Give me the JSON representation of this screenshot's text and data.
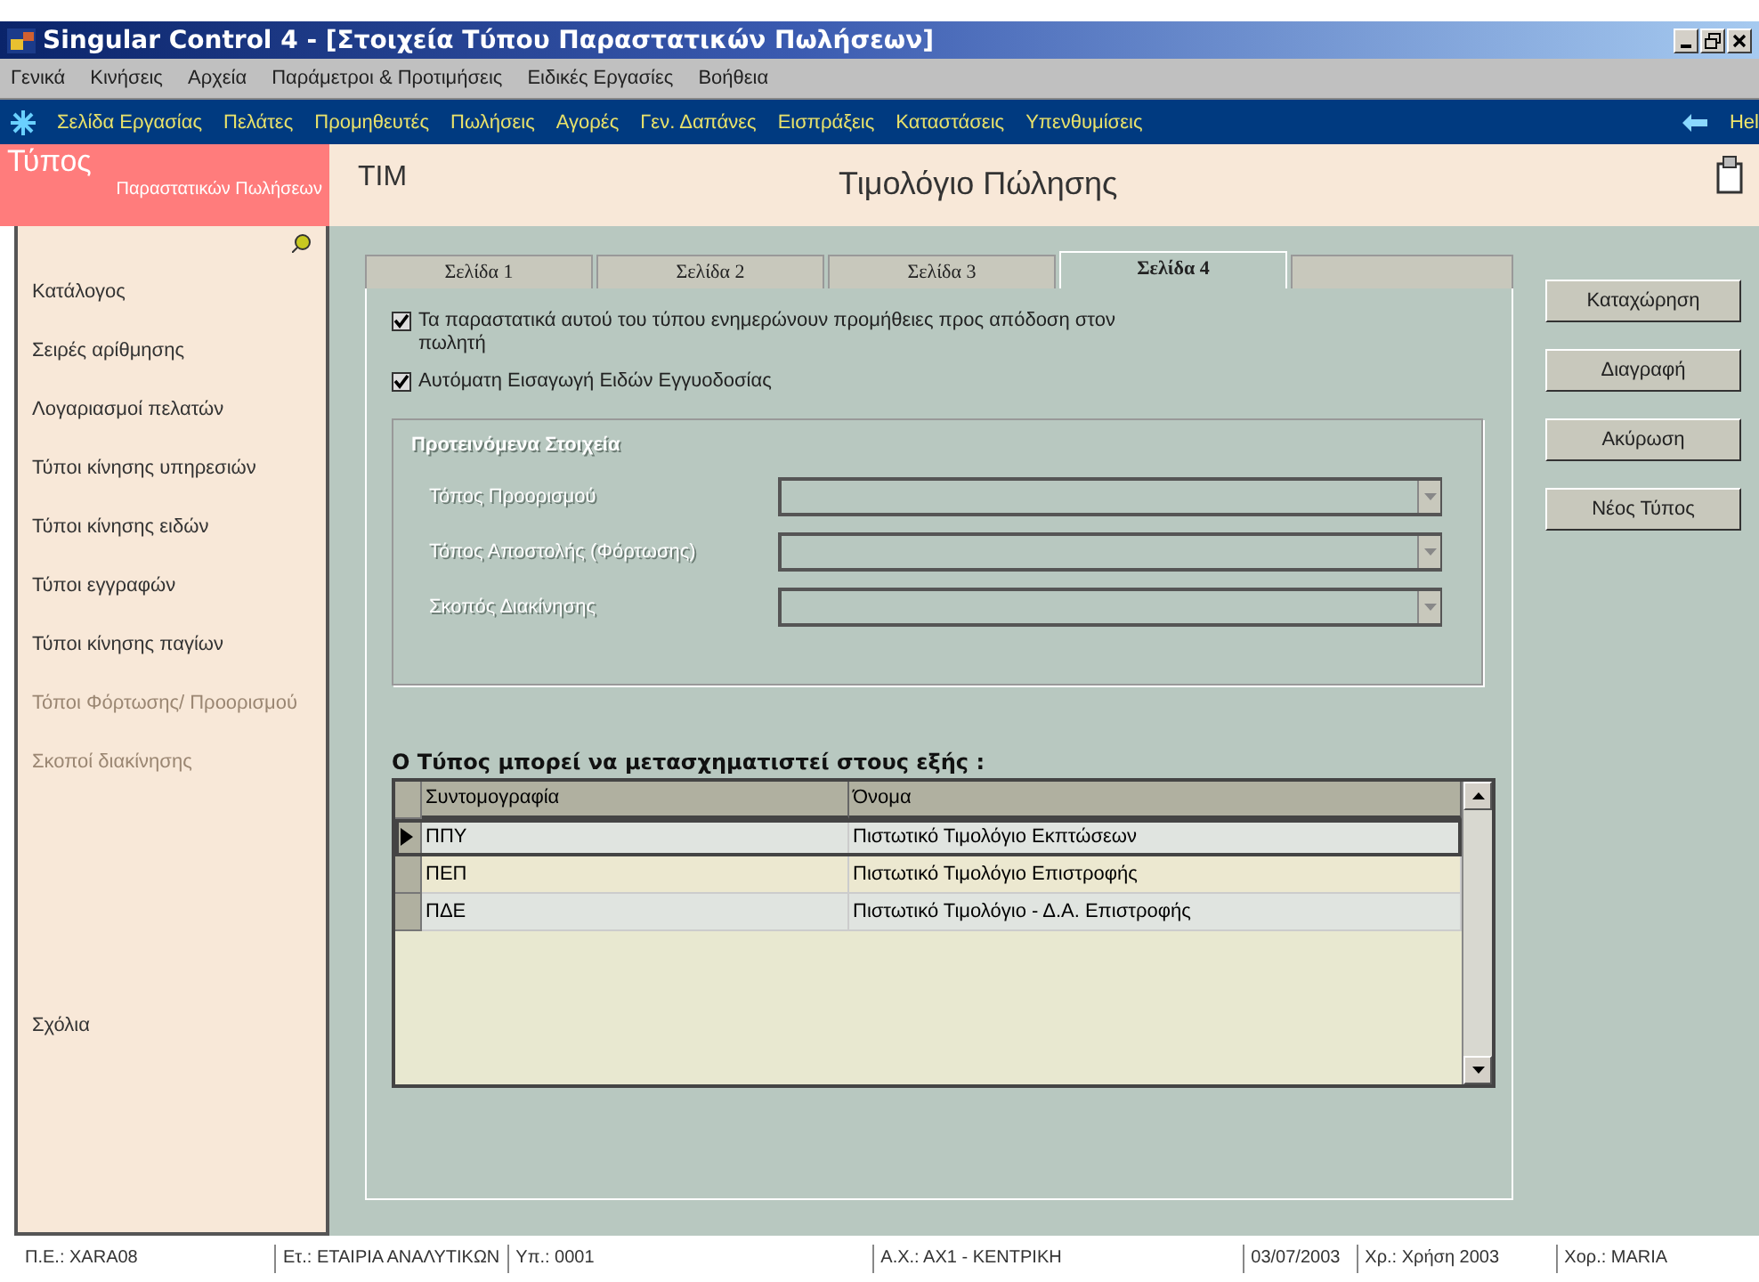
{
  "window": {
    "title": "Singular Control 4 - [Στοιχεία Τύπου Παραστατικών Πωλήσεων]"
  },
  "menu": [
    "Γενικά",
    "Κινήσεις",
    "Αρχεία",
    "Παράμετροι & Προτιμήσεις",
    "Ειδικές Εργασίες",
    "Βοήθεια"
  ],
  "nav": {
    "items": [
      "Σελίδα Εργασίας",
      "Πελάτες",
      "Προμηθευτές",
      "Πωλήσεις",
      "Αγορές",
      "Γεν. Δαπάνες",
      "Εισπράξεις",
      "Καταστάσεις",
      "Υπενθυμίσεις"
    ],
    "help": "Hel"
  },
  "header": {
    "title": "Τύπος",
    "subtitle": "Παραστατικών Πωλήσεων",
    "code": "TIM",
    "name": "Τιμολόγιο Πώλησης"
  },
  "sidebar": {
    "items": [
      {
        "label": "Κατάλογος",
        "disabled": false
      },
      {
        "label": "Σειρές αρίθμησης",
        "disabled": false
      },
      {
        "label": "Λογαριασμοί πελατών",
        "disabled": false
      },
      {
        "label": "Τύποι κίνησης υπηρεσιών",
        "disabled": false
      },
      {
        "label": "Τύποι κίνησης ειδών",
        "disabled": false
      },
      {
        "label": "Τύποι εγγραφών",
        "disabled": false
      },
      {
        "label": "Τύποι κίνησης παγίων",
        "disabled": false
      },
      {
        "label": "Τόποι Φόρτωσης/ Προορισμού",
        "disabled": true
      },
      {
        "label": "Σκοποί διακίνησης",
        "disabled": true
      }
    ],
    "notes": "Σχόλια"
  },
  "tabs": [
    {
      "label": "Σελίδα 1",
      "selected": false
    },
    {
      "label": "Σελίδα 2",
      "selected": false
    },
    {
      "label": "Σελίδα 3",
      "selected": false
    },
    {
      "label": "Σελίδα 4",
      "selected": true
    }
  ],
  "checkboxes": [
    {
      "label": "Τα παραστατικά αυτού του τύπου ενημερώνουν προμήθειες προς απόδοση στον πωλητή",
      "checked": true
    },
    {
      "label": "Αυτόματη Εισαγωγή Ειδών Εγγυοδοσίας",
      "checked": true
    }
  ],
  "group": {
    "title": "Προτεινόμενα Στοιχεία",
    "disabled": true,
    "fields": [
      {
        "label": "Τόπος Προορισμού"
      },
      {
        "label": "Τόπος Αποστολής (Φόρτωσης)"
      },
      {
        "label": "Σκοπός Διακίνησης"
      }
    ]
  },
  "table": {
    "caption": "Ο Τύπος μπορεί να μετασχηματιστεί στους εξής :",
    "columns": [
      "Συντομογραφία",
      "Όνομα"
    ],
    "rows": [
      {
        "cells": [
          "ΠΠΥ",
          "Πιστωτικό Τιμολόγιο Εκπτώσεων"
        ],
        "selected": true
      },
      {
        "cells": [
          "ΠΕΠ",
          "Πιστωτικό Τιμολόγιο Επιστροφής"
        ],
        "selected": false
      },
      {
        "cells": [
          "ΠΔΕ",
          "Πιστωτικό Τιμολόγιο - Δ.Α. Επιστροφής"
        ],
        "selected": false
      }
    ]
  },
  "buttons": [
    "Καταχώρηση",
    "Διαγραφή",
    "Ακύρωση",
    "Νέος Τύπος"
  ],
  "status_bar": [
    "Π.Ε.: XARA08",
    "Ετ.: ΕΤΑΙΡΙΑ ΑΝΑΛΥΤΙΚΩΝ",
    "Υπ.: 0001",
    "Α.Χ.: ΑΧ1 - ΚΕΝΤΡΙΚΗ",
    "03/07/2003",
    "Χρ.: Χρήση 2003",
    "Χορ.: MARIA"
  ]
}
